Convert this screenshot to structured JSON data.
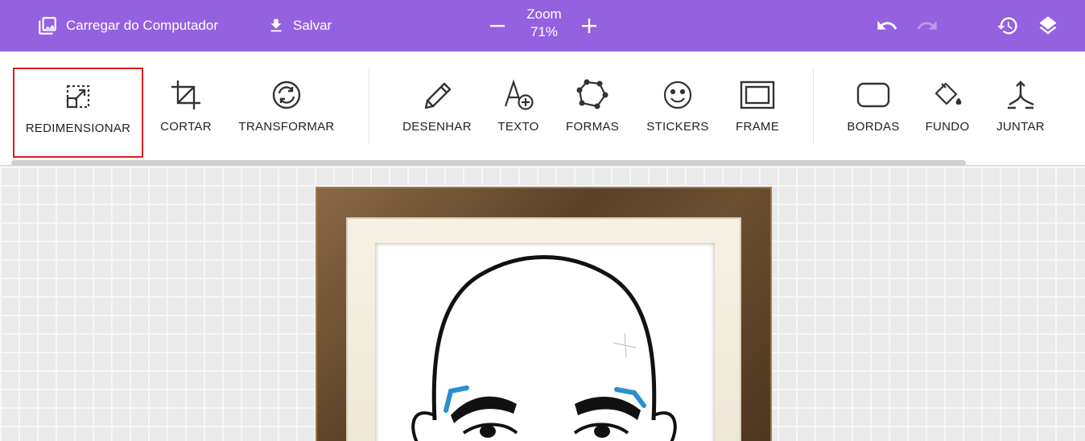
{
  "topbar": {
    "upload_label": "Carregar do Computador",
    "save_label": "Salvar",
    "zoom_title": "Zoom",
    "zoom_value": "71%",
    "icons": [
      "image-icon",
      "download-icon",
      "minus-icon",
      "plus-icon",
      "undo-icon",
      "redo-icon",
      "history-icon",
      "layers-icon"
    ]
  },
  "toolbar": {
    "selected": "REDIMENSIONAR",
    "tools": [
      {
        "label": "REDIMENSIONAR",
        "icon": "resize-icon"
      },
      {
        "label": "CORTAR",
        "icon": "crop-icon"
      },
      {
        "label": "TRANSFORMAR",
        "icon": "transform-icon"
      },
      {
        "label": "DESENHAR",
        "icon": "pencil-icon"
      },
      {
        "label": "TEXTO",
        "icon": "text-add-icon"
      },
      {
        "label": "FORMAS",
        "icon": "shapes-icon"
      },
      {
        "label": "STICKERS",
        "icon": "smiley-icon"
      },
      {
        "label": "FRAME",
        "icon": "frame-icon"
      },
      {
        "label": "BORDAS",
        "icon": "rounded-rect-icon"
      },
      {
        "label": "FUNDO",
        "icon": "paint-bucket-icon"
      },
      {
        "label": "JUNTAR",
        "icon": "merge-icon"
      }
    ]
  },
  "colors": {
    "topbar": "#9461e0",
    "selected_outline": "#e01b1b",
    "eyebrow_accent": "#2a8fd0"
  }
}
